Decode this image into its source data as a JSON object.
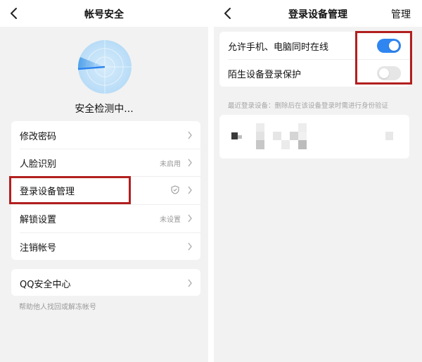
{
  "left": {
    "title": "帐号安全",
    "scan_status": "安全检测中...",
    "menu": [
      {
        "label": "修改密码",
        "value": ""
      },
      {
        "label": "人脸识别",
        "value": "未启用"
      },
      {
        "label": "登录设备管理",
        "value": "",
        "icon": "shield-icon"
      },
      {
        "label": "解锁设置",
        "value": "未设置"
      },
      {
        "label": "注销帐号",
        "value": ""
      }
    ],
    "qq_center": "QQ安全中心",
    "help_text": "帮助他人找回或解冻帐号"
  },
  "right": {
    "title": "登录设备管理",
    "manage_label": "管理",
    "toggles": [
      {
        "label": "允许手机、电脑同时在线",
        "on": true
      },
      {
        "label": "陌生设备登录保护",
        "on": false
      }
    ],
    "section_hint": "最近登录设备：删除后在该设备登录时需进行身份验证"
  },
  "colors": {
    "accent": "#2f86f0",
    "highlight_border": "#b21f1f",
    "radar": "#b8dcf7"
  }
}
